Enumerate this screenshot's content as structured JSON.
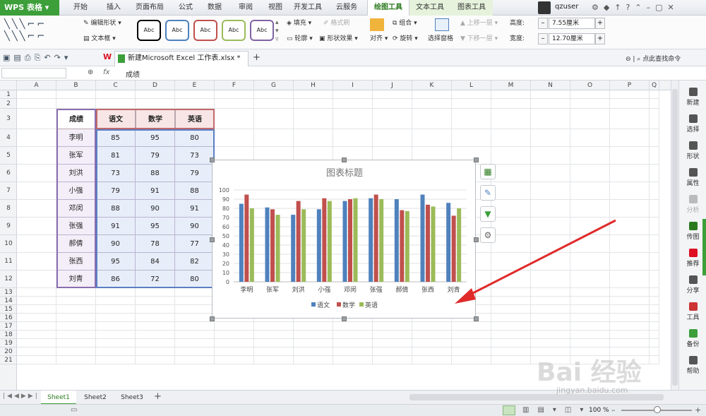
{
  "app": {
    "name": "WPS 表格"
  },
  "menu_tabs": [
    "开始",
    "插入",
    "页面布局",
    "公式",
    "数据",
    "审阅",
    "视图",
    "开发工具",
    "云服务",
    "绘图工具",
    "文本工具",
    "图表工具"
  ],
  "menu_active": "绘图工具",
  "user": {
    "name": "qzuser"
  },
  "ribbon": {
    "edit_shape": "编辑形状",
    "text_box": "文本框",
    "styles": [
      "Abc",
      "Abc",
      "Abc",
      "Abc",
      "Abc"
    ],
    "style_colors": [
      "#000000",
      "#4f81bd",
      "#c0504d",
      "#9bbb59",
      "#8064a2"
    ],
    "fill": "填充",
    "format_brush": "格式刷",
    "outline": "轮廓",
    "shape_effect": "形状效果",
    "align": "对齐",
    "group": "组合",
    "rotate": "旋转",
    "select_pane": "选择窗格",
    "bring_forward": "上移一层",
    "send_backward": "下移一层",
    "height_label": "高度:",
    "height_value": "7.55厘米",
    "width_label": "宽度:",
    "width_value": "12.70厘米"
  },
  "file_tab": "新建Microsoft Excel 工作表.xlsx *",
  "find_command": "点此查找命令",
  "formula": {
    "name_box": "",
    "fx": "fx",
    "content": "成绩"
  },
  "columns": [
    "A",
    "B",
    "C",
    "D",
    "E",
    "F",
    "G",
    "H",
    "I",
    "J",
    "K",
    "L",
    "M",
    "N",
    "O",
    "P",
    "Q"
  ],
  "rows": [
    "1",
    "2",
    "3",
    "4",
    "5",
    "6",
    "7",
    "8",
    "9",
    "10",
    "11",
    "12",
    "13",
    "14",
    "15",
    "16",
    "17",
    "18",
    "19",
    "20",
    "21"
  ],
  "table": {
    "header": [
      "成绩",
      "语文",
      "数学",
      "英语"
    ],
    "data": [
      [
        "李明",
        "85",
        "95",
        "80"
      ],
      [
        "张军",
        "81",
        "79",
        "73"
      ],
      [
        "刘洪",
        "73",
        "88",
        "79"
      ],
      [
        "小强",
        "79",
        "91",
        "88"
      ],
      [
        "邓闵",
        "88",
        "90",
        "91"
      ],
      [
        "张强",
        "91",
        "95",
        "90"
      ],
      [
        "郝倩",
        "90",
        "78",
        "77"
      ],
      [
        "张西",
        "95",
        "84",
        "82"
      ],
      [
        "刘青",
        "86",
        "72",
        "80"
      ]
    ]
  },
  "right_panel": [
    "新建",
    "选择",
    "形状",
    "属性",
    "分析",
    "传图",
    "推荐",
    "分享",
    "工具",
    "备份",
    "帮助"
  ],
  "sheets": [
    "Sheet1",
    "Sheet2",
    "Sheet3"
  ],
  "active_sheet": "Sheet1",
  "zoom": "100 %",
  "watermark": "Bai 经验",
  "watermark_url": "jingyan.baidu.com",
  "chart_data": {
    "type": "bar",
    "title": "图表标题",
    "categories": [
      "李明",
      "张军",
      "刘洪",
      "小强",
      "邓闵",
      "张强",
      "郝倩",
      "张西",
      "刘青"
    ],
    "series": [
      {
        "name": "语文",
        "color": "#4f81bd",
        "values": [
          85,
          81,
          73,
          79,
          88,
          91,
          90,
          95,
          86
        ]
      },
      {
        "name": "数学",
        "color": "#c0504d",
        "values": [
          95,
          79,
          88,
          91,
          90,
          95,
          78,
          84,
          72
        ]
      },
      {
        "name": "英语",
        "color": "#9bbb59",
        "values": [
          80,
          73,
          79,
          88,
          91,
          90,
          77,
          82,
          80
        ]
      }
    ],
    "yticks": [
      "0",
      "10",
      "20",
      "30",
      "40",
      "50",
      "60",
      "70",
      "80",
      "90",
      "100"
    ],
    "ylim": [
      0,
      100
    ],
    "legend_position": "bottom",
    "grid": true
  }
}
